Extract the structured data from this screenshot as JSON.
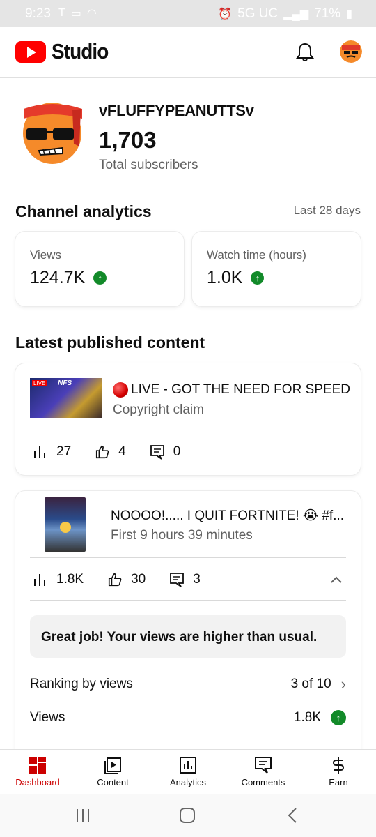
{
  "status_bar": {
    "time": "9:23",
    "network": "5G UC",
    "battery": "71%"
  },
  "header": {
    "logo_text": "Studio",
    "icons": [
      "youtube-logo-icon",
      "bell-icon",
      "account-avatar"
    ]
  },
  "channel": {
    "name": "vFLUFFYPEANUTTSv",
    "subscribers": "1,703",
    "subscribers_label": "Total subscribers"
  },
  "analytics": {
    "title": "Channel analytics",
    "period": "Last 28 days",
    "cards": [
      {
        "label": "Views",
        "value": "124.7K",
        "trend": "up"
      },
      {
        "label": "Watch time (hours)",
        "value": "1.0K",
        "trend": "up"
      }
    ]
  },
  "latest": {
    "title": "Latest published content",
    "videos": [
      {
        "title": "LIVE - GOT THE NEED FOR SPEED",
        "subtitle": "Copyright claim",
        "thumb_badge": "LIVE",
        "thumb_text": "NFS",
        "views": "27",
        "likes": "4",
        "comments": "0"
      },
      {
        "title": "NOOOO!..... I QUIT FORTNITE! 😭 #f...",
        "subtitle": "First 9 hours 39 minutes",
        "views": "1.8K",
        "likes": "30",
        "comments": "3",
        "praise": "Great job! Your views are higher than usual.",
        "ranking_label": "Ranking by views",
        "ranking_value": "3 of 10",
        "views_label": "Views",
        "views_value": "1.8K"
      }
    ]
  },
  "bottom_nav": [
    {
      "label": "Dashboard",
      "icon": "dashboard-icon",
      "active": true
    },
    {
      "label": "Content",
      "icon": "content-icon"
    },
    {
      "label": "Analytics",
      "icon": "analytics-icon"
    },
    {
      "label": "Comments",
      "icon": "comments-icon"
    },
    {
      "label": "Earn",
      "icon": "dollar-icon"
    }
  ],
  "colors": {
    "brand_red": "#ff0000",
    "active_nav": "#cc0000",
    "trend_up": "#128a29",
    "secondary_text": "#606060"
  }
}
